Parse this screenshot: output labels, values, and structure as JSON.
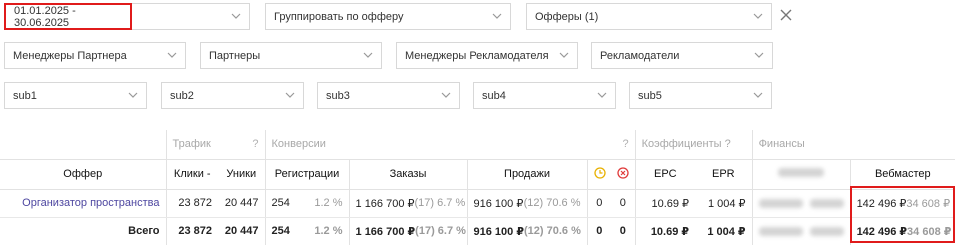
{
  "filters": {
    "date_range": "01.01.2025 - 30.06.2025",
    "group_by": "Группировать по офферу",
    "offers": "Офферы (1)",
    "partner_managers": "Менеджеры Партнера",
    "partners": "Партнеры",
    "advertiser_managers": "Менеджеры Рекламодателя",
    "advertisers": "Рекламодатели",
    "sub1": "sub1",
    "sub2": "sub2",
    "sub3": "sub3",
    "sub4": "sub4",
    "sub5": "sub5"
  },
  "table": {
    "groups": {
      "traffic": "Трафик",
      "conversions": "Конверсии",
      "coefficients": "Коэффициенты",
      "finance": "Финансы",
      "q": "?"
    },
    "headers": {
      "offer": "Оффер",
      "clicks": "Клики -",
      "uniques": "Уники",
      "registrations": "Регистрации",
      "orders": "Заказы",
      "sales": "Продажи",
      "epc": "EPC",
      "epr": "EPR",
      "webmaster": "Вебмастер"
    },
    "row": {
      "offer": "Организатор пространства",
      "clicks": "23 872",
      "uniques": "20 447",
      "reg": "254",
      "reg_pct": "1.2 %",
      "orders": "1 166 700 ₽",
      "orders_extra": "(17) 6.7 %",
      "sales": "916 100 ₽",
      "sales_extra": "(12) 70.6 %",
      "pending": "0",
      "rejected": "0",
      "epc": "10.69 ₽",
      "epr": "1 004 ₽",
      "web": "142 496 ₽",
      "web_extra": "34 608 ₽"
    },
    "total": {
      "offer": "Всего",
      "clicks": "23 872",
      "uniques": "20 447",
      "reg": "254",
      "reg_pct": "1.2 %",
      "orders": "1 166 700 ₽",
      "orders_extra": "(17) 6.7 %",
      "sales": "916 100 ₽",
      "sales_extra": "(12) 70.6 %",
      "pending": "0",
      "rejected": "0",
      "epc": "10.69 ₽",
      "epr": "1 004 ₽",
      "web": "142 496 ₽",
      "web_extra": "34 608 ₽"
    }
  },
  "colors": {
    "highlight": "#e01b1b",
    "link": "#4d46a0",
    "pending": "#e8b100",
    "rejected": "#e03a3a"
  },
  "icons": {
    "chevron": "chevron-down-icon",
    "close": "close-icon",
    "pending": "clock-icon",
    "rejected": "reject-icon"
  }
}
